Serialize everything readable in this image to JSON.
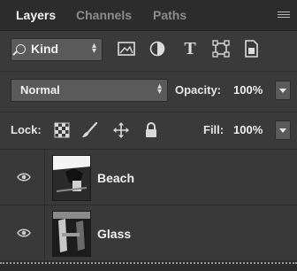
{
  "tabs": [
    {
      "label": "Layers",
      "active": true
    },
    {
      "label": "Channels",
      "active": false
    },
    {
      "label": "Paths",
      "active": false
    }
  ],
  "filter": {
    "kind_label": "Kind",
    "icons": [
      "image-filter-icon",
      "adjustment-filter-icon",
      "type-filter-icon",
      "shape-filter-icon",
      "smart-object-filter-icon"
    ],
    "type_glyph": "T"
  },
  "blend": {
    "mode": "Normal",
    "opacity_label": "Opacity:",
    "opacity_value": "100%"
  },
  "lock": {
    "label": "Lock:",
    "icons": [
      "lock-transparent-pixels-icon",
      "lock-image-pixels-icon",
      "lock-position-icon",
      "lock-all-icon"
    ],
    "fill_label": "Fill:",
    "fill_value": "100%"
  },
  "layers": [
    {
      "name": "Beach",
      "visible": true
    },
    {
      "name": "Glass",
      "visible": true
    }
  ],
  "colors": {
    "panel_bg": "#3a3a3a",
    "tab_bar_bg": "#2c2c2c",
    "control_bg": "#5a5a5a",
    "text": "#e6e6e6"
  }
}
